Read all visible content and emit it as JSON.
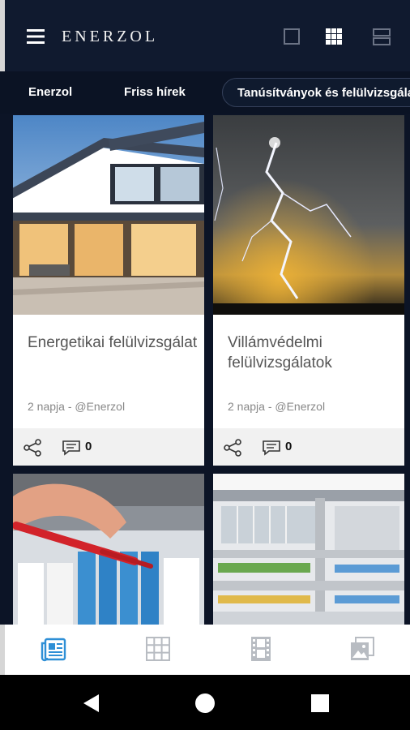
{
  "app": {
    "brand": "ENERZOL",
    "accent_color": "#2e8fd6",
    "header_color": "#101a2f"
  },
  "header": {
    "icons": [
      "hamburger-menu-icon",
      "single-view-icon",
      "grid-view-icon",
      "list-view-icon"
    ]
  },
  "tabs": [
    {
      "label": "Enerzol"
    },
    {
      "label": "Friss hírek"
    },
    {
      "label": "Tanúsítványok és felülvizsgálatok",
      "active": true
    }
  ],
  "cards": [
    {
      "title": "Energetikai felülvizsgálat",
      "meta": "2 napja - @Enerzol",
      "comments": "0",
      "image": "modern-house-photo"
    },
    {
      "title": "Villámvédelmi felülvizsgálatok",
      "meta": "2 napja - @Enerzol",
      "comments": "0",
      "image": "lightning-storm-photo"
    },
    {
      "image": "electrical-tester-photo"
    },
    {
      "image": "electrical-cabinet-photo"
    }
  ],
  "bottom_nav": [
    {
      "icon": "news-icon",
      "active": true
    },
    {
      "icon": "grid-icon"
    },
    {
      "icon": "video-film-icon"
    },
    {
      "icon": "gallery-icon"
    }
  ],
  "system_nav": [
    "back-icon",
    "home-icon",
    "recents-icon"
  ]
}
